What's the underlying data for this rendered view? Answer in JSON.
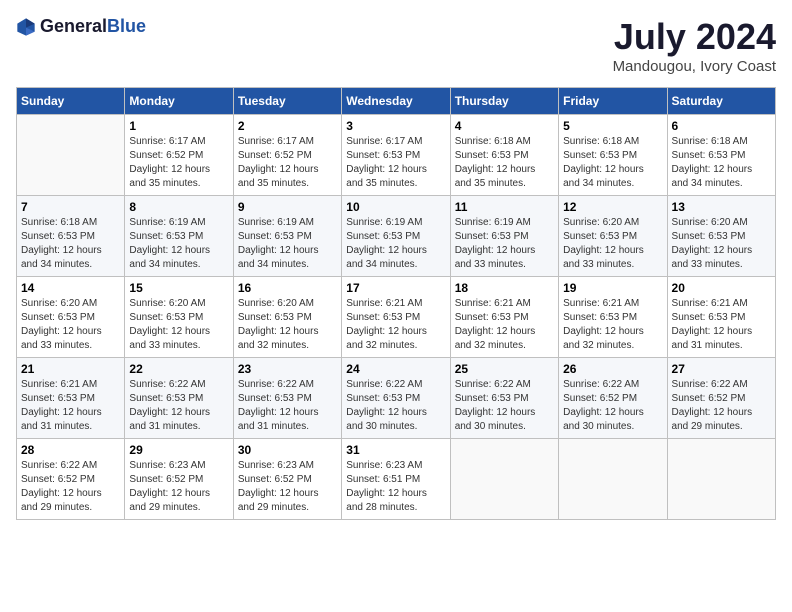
{
  "logo": {
    "text_general": "General",
    "text_blue": "Blue"
  },
  "header": {
    "month_year": "July 2024",
    "location": "Mandougou, Ivory Coast"
  },
  "days_of_week": [
    "Sunday",
    "Monday",
    "Tuesday",
    "Wednesday",
    "Thursday",
    "Friday",
    "Saturday"
  ],
  "weeks": [
    [
      {
        "day": "",
        "sunrise": "",
        "sunset": "",
        "daylight": ""
      },
      {
        "day": "1",
        "sunrise": "Sunrise: 6:17 AM",
        "sunset": "Sunset: 6:52 PM",
        "daylight": "Daylight: 12 hours and 35 minutes."
      },
      {
        "day": "2",
        "sunrise": "Sunrise: 6:17 AM",
        "sunset": "Sunset: 6:52 PM",
        "daylight": "Daylight: 12 hours and 35 minutes."
      },
      {
        "day": "3",
        "sunrise": "Sunrise: 6:17 AM",
        "sunset": "Sunset: 6:53 PM",
        "daylight": "Daylight: 12 hours and 35 minutes."
      },
      {
        "day": "4",
        "sunrise": "Sunrise: 6:18 AM",
        "sunset": "Sunset: 6:53 PM",
        "daylight": "Daylight: 12 hours and 35 minutes."
      },
      {
        "day": "5",
        "sunrise": "Sunrise: 6:18 AM",
        "sunset": "Sunset: 6:53 PM",
        "daylight": "Daylight: 12 hours and 34 minutes."
      },
      {
        "day": "6",
        "sunrise": "Sunrise: 6:18 AM",
        "sunset": "Sunset: 6:53 PM",
        "daylight": "Daylight: 12 hours and 34 minutes."
      }
    ],
    [
      {
        "day": "7",
        "sunrise": "Sunrise: 6:18 AM",
        "sunset": "Sunset: 6:53 PM",
        "daylight": "Daylight: 12 hours and 34 minutes."
      },
      {
        "day": "8",
        "sunrise": "Sunrise: 6:19 AM",
        "sunset": "Sunset: 6:53 PM",
        "daylight": "Daylight: 12 hours and 34 minutes."
      },
      {
        "day": "9",
        "sunrise": "Sunrise: 6:19 AM",
        "sunset": "Sunset: 6:53 PM",
        "daylight": "Daylight: 12 hours and 34 minutes."
      },
      {
        "day": "10",
        "sunrise": "Sunrise: 6:19 AM",
        "sunset": "Sunset: 6:53 PM",
        "daylight": "Daylight: 12 hours and 34 minutes."
      },
      {
        "day": "11",
        "sunrise": "Sunrise: 6:19 AM",
        "sunset": "Sunset: 6:53 PM",
        "daylight": "Daylight: 12 hours and 33 minutes."
      },
      {
        "day": "12",
        "sunrise": "Sunrise: 6:20 AM",
        "sunset": "Sunset: 6:53 PM",
        "daylight": "Daylight: 12 hours and 33 minutes."
      },
      {
        "day": "13",
        "sunrise": "Sunrise: 6:20 AM",
        "sunset": "Sunset: 6:53 PM",
        "daylight": "Daylight: 12 hours and 33 minutes."
      }
    ],
    [
      {
        "day": "14",
        "sunrise": "Sunrise: 6:20 AM",
        "sunset": "Sunset: 6:53 PM",
        "daylight": "Daylight: 12 hours and 33 minutes."
      },
      {
        "day": "15",
        "sunrise": "Sunrise: 6:20 AM",
        "sunset": "Sunset: 6:53 PM",
        "daylight": "Daylight: 12 hours and 33 minutes."
      },
      {
        "day": "16",
        "sunrise": "Sunrise: 6:20 AM",
        "sunset": "Sunset: 6:53 PM",
        "daylight": "Daylight: 12 hours and 32 minutes."
      },
      {
        "day": "17",
        "sunrise": "Sunrise: 6:21 AM",
        "sunset": "Sunset: 6:53 PM",
        "daylight": "Daylight: 12 hours and 32 minutes."
      },
      {
        "day": "18",
        "sunrise": "Sunrise: 6:21 AM",
        "sunset": "Sunset: 6:53 PM",
        "daylight": "Daylight: 12 hours and 32 minutes."
      },
      {
        "day": "19",
        "sunrise": "Sunrise: 6:21 AM",
        "sunset": "Sunset: 6:53 PM",
        "daylight": "Daylight: 12 hours and 32 minutes."
      },
      {
        "day": "20",
        "sunrise": "Sunrise: 6:21 AM",
        "sunset": "Sunset: 6:53 PM",
        "daylight": "Daylight: 12 hours and 31 minutes."
      }
    ],
    [
      {
        "day": "21",
        "sunrise": "Sunrise: 6:21 AM",
        "sunset": "Sunset: 6:53 PM",
        "daylight": "Daylight: 12 hours and 31 minutes."
      },
      {
        "day": "22",
        "sunrise": "Sunrise: 6:22 AM",
        "sunset": "Sunset: 6:53 PM",
        "daylight": "Daylight: 12 hours and 31 minutes."
      },
      {
        "day": "23",
        "sunrise": "Sunrise: 6:22 AM",
        "sunset": "Sunset: 6:53 PM",
        "daylight": "Daylight: 12 hours and 31 minutes."
      },
      {
        "day": "24",
        "sunrise": "Sunrise: 6:22 AM",
        "sunset": "Sunset: 6:53 PM",
        "daylight": "Daylight: 12 hours and 30 minutes."
      },
      {
        "day": "25",
        "sunrise": "Sunrise: 6:22 AM",
        "sunset": "Sunset: 6:53 PM",
        "daylight": "Daylight: 12 hours and 30 minutes."
      },
      {
        "day": "26",
        "sunrise": "Sunrise: 6:22 AM",
        "sunset": "Sunset: 6:52 PM",
        "daylight": "Daylight: 12 hours and 30 minutes."
      },
      {
        "day": "27",
        "sunrise": "Sunrise: 6:22 AM",
        "sunset": "Sunset: 6:52 PM",
        "daylight": "Daylight: 12 hours and 29 minutes."
      }
    ],
    [
      {
        "day": "28",
        "sunrise": "Sunrise: 6:22 AM",
        "sunset": "Sunset: 6:52 PM",
        "daylight": "Daylight: 12 hours and 29 minutes."
      },
      {
        "day": "29",
        "sunrise": "Sunrise: 6:23 AM",
        "sunset": "Sunset: 6:52 PM",
        "daylight": "Daylight: 12 hours and 29 minutes."
      },
      {
        "day": "30",
        "sunrise": "Sunrise: 6:23 AM",
        "sunset": "Sunset: 6:52 PM",
        "daylight": "Daylight: 12 hours and 29 minutes."
      },
      {
        "day": "31",
        "sunrise": "Sunrise: 6:23 AM",
        "sunset": "Sunset: 6:51 PM",
        "daylight": "Daylight: 12 hours and 28 minutes."
      },
      {
        "day": "",
        "sunrise": "",
        "sunset": "",
        "daylight": ""
      },
      {
        "day": "",
        "sunrise": "",
        "sunset": "",
        "daylight": ""
      },
      {
        "day": "",
        "sunrise": "",
        "sunset": "",
        "daylight": ""
      }
    ]
  ]
}
